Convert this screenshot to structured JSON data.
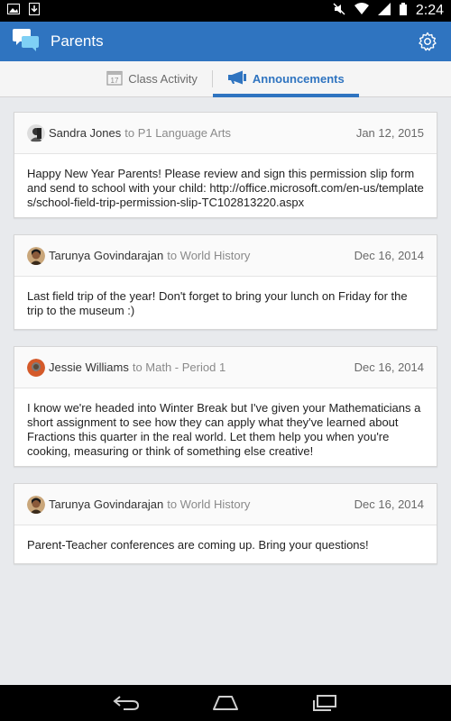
{
  "status_bar": {
    "time": "2:24",
    "icons": [
      "image-notification-icon",
      "download-icon",
      "mute-icon",
      "wifi-icon",
      "signal-icon",
      "battery-icon"
    ]
  },
  "app_bar": {
    "title": "Parents",
    "color": "#2f74c0",
    "icons": [
      "chat-bubbles-logo-icon",
      "gear-icon"
    ]
  },
  "tabs": [
    {
      "label": "Class Activity",
      "icon": "calendar-icon",
      "day": "17",
      "active": false
    },
    {
      "label": "Announcements",
      "icon": "megaphone-icon",
      "active": true
    }
  ],
  "announcements": [
    {
      "author": "Sandra Jones",
      "recipient": "to P1 Language Arts",
      "date": "Jan 12, 2015",
      "text": "Happy New Year Parents! Please review and sign this permission slip form and send to school with your child: http://office.microsoft.com/en-us/templates/school-field-trip-permission-slip-TC102813220.aspx"
    },
    {
      "author": "Tarunya Govindarajan",
      "recipient": "to World History",
      "date": "Dec 16, 2014",
      "text": "Last field trip of the year!  Don't forget to bring your lunch on Friday for the trip to the museum :)"
    },
    {
      "author": "Jessie Williams",
      "recipient": "to Math - Period 1",
      "date": "Dec 16, 2014",
      "text": "I know we're headed into Winter Break but I've given your Mathematicians a short assignment to see how they can apply what they've learned about Fractions this quarter in the real world.  Let them help you when you're cooking, measuring or think of something else creative!"
    },
    {
      "author": "Tarunya Govindarajan",
      "recipient": "to World History",
      "date": "Dec 16, 2014",
      "text": "Parent-Teacher conferences are coming up.  Bring your questions!"
    }
  ],
  "nav_bar": {
    "buttons": [
      "back-icon",
      "home-icon",
      "recents-icon"
    ]
  }
}
